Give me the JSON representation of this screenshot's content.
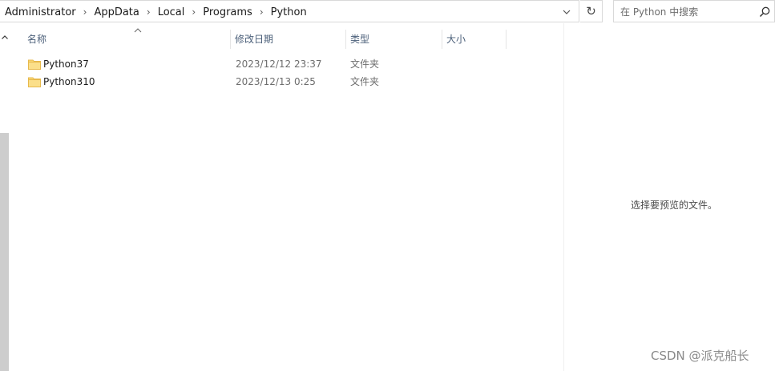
{
  "address_bar": {
    "breadcrumb": [
      "Administrator",
      "AppData",
      "Local",
      "Programs",
      "Python"
    ],
    "separator": "›"
  },
  "refresh_glyph": "↻",
  "search": {
    "placeholder": "在 Python 中搜索"
  },
  "columns": {
    "name": "名称",
    "date": "修改日期",
    "type": "类型",
    "size": "大小"
  },
  "sort": {
    "column": "名称",
    "direction": "ascending"
  },
  "files": [
    {
      "name": "Python37",
      "modified": "2023/12/12 23:37",
      "type": "文件夹",
      "size": ""
    },
    {
      "name": "Python310",
      "modified": "2023/12/13 0:25",
      "type": "文件夹",
      "size": ""
    }
  ],
  "preview": {
    "message": "选择要预览的文件。"
  },
  "watermark": "CSDN @派克船长",
  "colors": {
    "folder": "#f8d775",
    "folder_dark": "#e7b94c",
    "header_text": "#4c607a",
    "scroll_thumb": "#cdcdcd"
  },
  "icons": {
    "dropdown": "chevron-down-icon",
    "refresh": "refresh-icon",
    "search": "search-icon",
    "folder": "folder-icon",
    "sort": "sort-up-icon",
    "scroll_up": "chevron-up-icon"
  }
}
